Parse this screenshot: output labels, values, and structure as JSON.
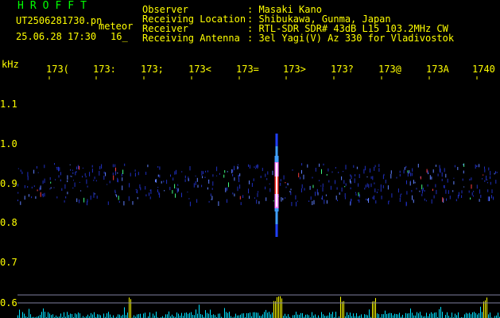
{
  "header": {
    "software_title": "HROFFT",
    "file_name": "UT2506281730.pn",
    "file_suffix": "meteor",
    "date_time": "25.06.28 17:30",
    "frame_no": "16_"
  },
  "info": {
    "labels": [
      "Observer",
      "Receiving Location",
      "Receiver",
      "Receiving Antenna"
    ],
    "values": [
      ": Masaki Kano",
      ": Shibukawa, Gunma, Japan",
      ": RTL-SDR SDR# 43dB L15 103.2MHz CW",
      ": 3el Yagi(V) Az 330 for Vladivostok"
    ]
  },
  "axis": {
    "y_unit": "kHz",
    "x_ticks": [
      "173(",
      "173:",
      "173;",
      "173<",
      "173=",
      "173>",
      "173?",
      "173@",
      "173A",
      "1740"
    ],
    "y_ticks": [
      "1.1",
      "1.0",
      "0.9",
      "0.8",
      "0.7",
      "0.6"
    ]
  },
  "colors": {
    "title_text": "#00ff00",
    "header_text": "#ffff00",
    "axis_text": "#ffff00",
    "meteor_core": "#ff3030",
    "noise": "#3050ff",
    "spectrum": "#00e0ff",
    "spectrum_peak": "#ffff00",
    "baseline": "#8080a0"
  }
}
